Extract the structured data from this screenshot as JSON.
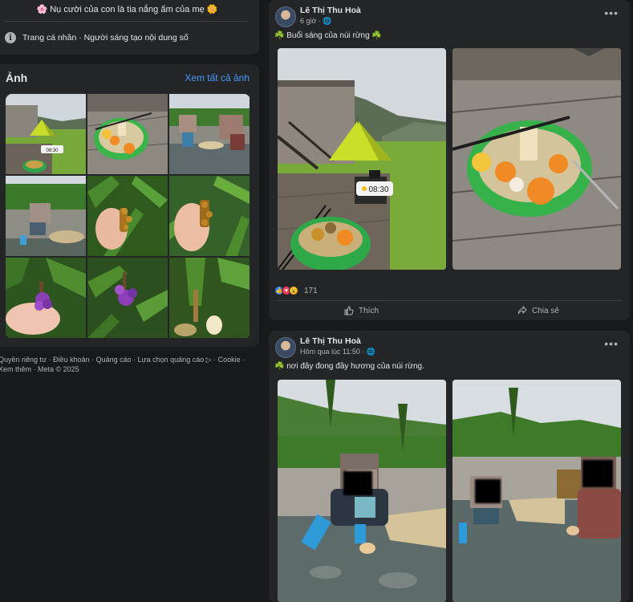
{
  "intro": {
    "bio": "🌸 Nụ cười của con là tia nắng ấm của mẹ 🌼",
    "category": "Trang cá nhân · Người sáng tạo nội dung số"
  },
  "photos": {
    "title": "Ảnh",
    "see_all": "Xem tất cả ảnh",
    "clock": "08:30"
  },
  "footer": {
    "links": "Quyền riêng tư · Điều khoản · Quảng cáo · Lựa chọn quảng cáo ▷ · Cookie · Xem thêm · Meta © 2025"
  },
  "posts": [
    {
      "author": "Lê Thị Thu Hoà",
      "time": "6 giờ · 🌐",
      "caption": "☘️ Buổi sáng của núi rừng ☘️",
      "clock": "08:30",
      "reaction_count": "171",
      "like_label": "Thích",
      "share_label": "Chia sẻ"
    },
    {
      "author": "Lê Thị Thu Hoà",
      "time": "Hôm qua lúc 11:50 · 🌐",
      "caption": "☘️ nơi đây đong đầy hương của núi rừng."
    }
  ],
  "colors": {
    "page_bg": "#18191a",
    "card_bg": "#242526",
    "link_blue": "#4599ff",
    "muted_text": "#b0b3b8"
  }
}
